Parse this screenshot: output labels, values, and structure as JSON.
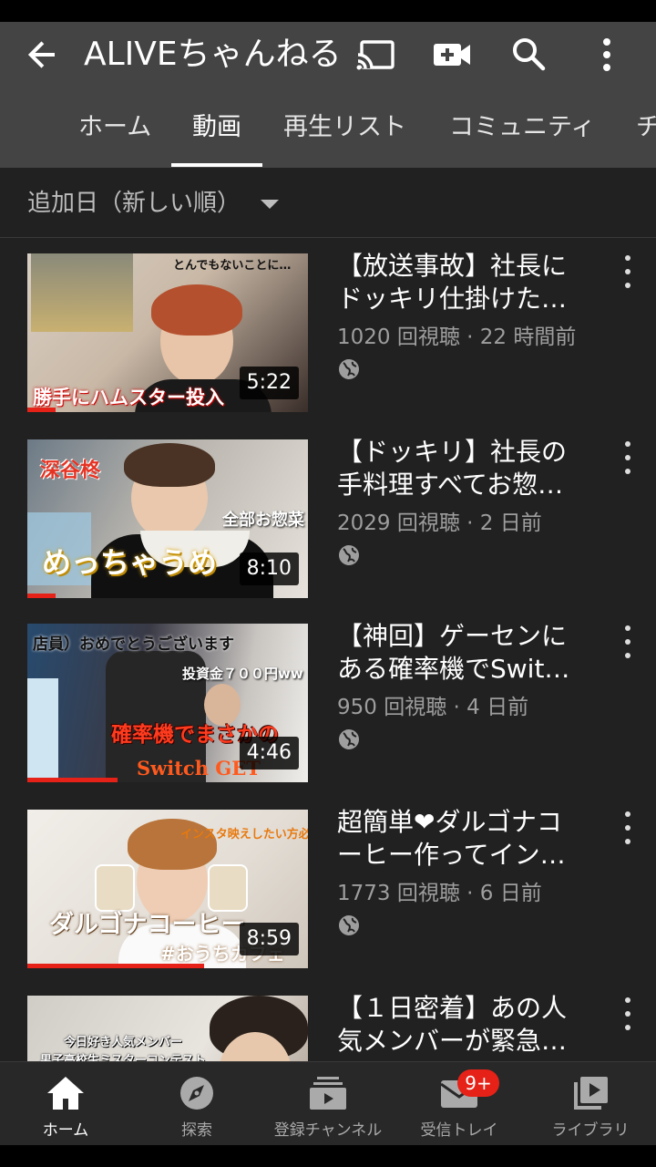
{
  "header": {
    "title": "ALIVEちゃんねる",
    "icons": [
      "back-arrow-icon",
      "cast-icon",
      "camera-icon",
      "search-icon",
      "more-vert-icon"
    ]
  },
  "tabs": [
    {
      "label": "ホーム",
      "active": false
    },
    {
      "label": "動画",
      "active": true
    },
    {
      "label": "再生リスト",
      "active": false
    },
    {
      "label": "コミュニティ",
      "active": false
    },
    {
      "label": "チ",
      "active": false
    }
  ],
  "sort": {
    "label": "追加日（新しい順）"
  },
  "videos": [
    {
      "title_line1": "【放送事故】社長に",
      "title_line2": "ドッキリ仕掛けた…",
      "meta": "1020 回視聴 · 22 時間前",
      "duration": "5:22",
      "watched": 0.1,
      "overlay_text": [
        "とんでもないことに…",
        "勝手にハムスター投入"
      ],
      "visibility_icon": "globe-icon"
    },
    {
      "title_line1": "【ドッキリ】社長の",
      "title_line2": "手料理すべてお惣…",
      "meta": "2029 回視聴 · 2 日前",
      "duration": "8:10",
      "watched": 0.1,
      "overlay_text": [
        "深谷柊",
        "全部お惣菜",
        "めっちゃうめ"
      ],
      "visibility_icon": "globe-icon"
    },
    {
      "title_line1": "【神回】ゲーセンに",
      "title_line2": "ある確率機でSwit…",
      "meta": "950 回視聴 · 4 日前",
      "duration": "4:46",
      "watched": 0.32,
      "overlay_text": [
        "店員）おめでとうございます",
        "投資金７００円ww",
        "確率機でまさかの",
        "Switch GET"
      ],
      "visibility_icon": "globe-icon"
    },
    {
      "title_line1": "超簡単❤ダルゴナコ",
      "title_line2": "ーヒー作ってイン…",
      "meta": "1773 回視聴 · 6 日前",
      "duration": "8:59",
      "watched": 0.63,
      "overlay_text": [
        "インスタ映えしたい方必見",
        "ダルゴナコーヒー",
        "#おうちカフェ"
      ],
      "visibility_icon": "globe-icon"
    },
    {
      "title_line1": "【１日密着】あの人",
      "title_line2": "気メンバーが緊急…",
      "meta": "",
      "duration": "",
      "watched": 0,
      "overlay_text": [
        "今日好き人気メンバー",
        "男子高校生ミスターコンテスト"
      ],
      "visibility_icon": ""
    }
  ],
  "bottom_nav": [
    {
      "label": "ホーム",
      "icon": "home-icon",
      "active": true
    },
    {
      "label": "探索",
      "icon": "compass-icon",
      "active": false
    },
    {
      "label": "登録チャンネル",
      "icon": "subscriptions-icon",
      "active": false
    },
    {
      "label": "受信トレイ",
      "icon": "inbox-icon",
      "active": false,
      "badge": "9+"
    },
    {
      "label": "ライブラリ",
      "icon": "library-icon",
      "active": false
    }
  ],
  "colors": {
    "background": "#212121",
    "appbar": "#444444",
    "accent": "#e62117",
    "meta_text": "#9e9e9e"
  }
}
